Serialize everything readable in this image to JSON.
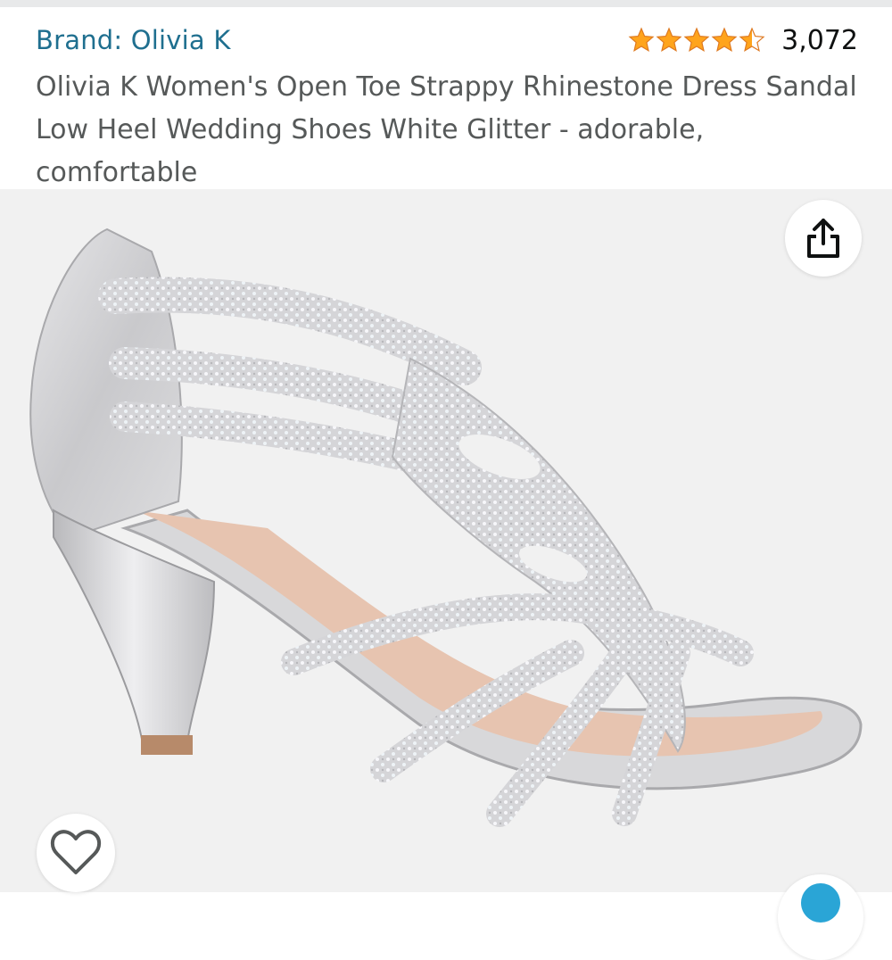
{
  "header": {
    "brand_label": "Brand: Olivia K",
    "rating": {
      "stars": 4.5,
      "max": 5,
      "count": "3,072"
    },
    "title": "Olivia K Women's Open Toe Strappy Rhinestone Dress Sandal Low Heel Wedding Shoes White Glitter - adorable, comfortable"
  },
  "image": {
    "subject": "silver rhinestone strappy heeled sandal",
    "share_icon": "share-icon",
    "wishlist_icon": "heart-icon"
  },
  "colors": {
    "brand_link": "#1f6f8f",
    "star": "#ffa41c",
    "title_text": "#565959",
    "image_bg": "#f1f1f1"
  }
}
